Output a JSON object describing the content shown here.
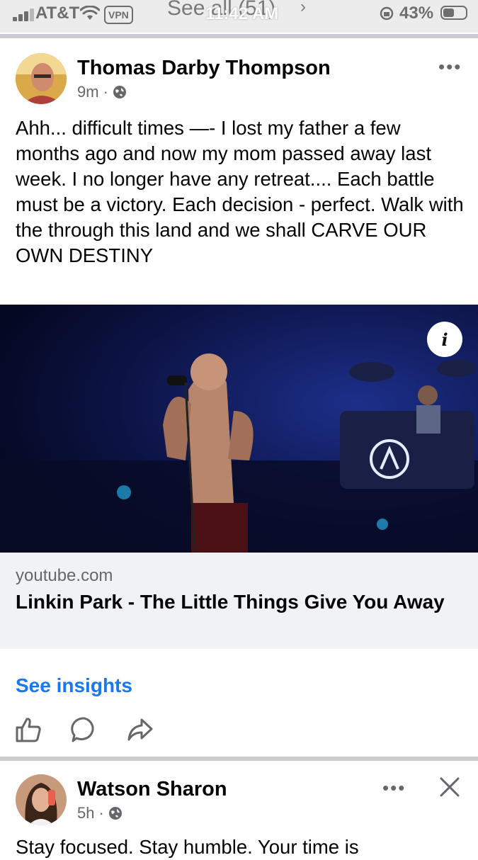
{
  "status_bar": {
    "carrier": "AT&T",
    "vpn_label": "VPN",
    "overlay_text": "See all (51)",
    "time": "11:42 AM",
    "battery_percent": "43%",
    "battery_level": 0.43
  },
  "post1": {
    "author": "Thomas Darby Thompson",
    "time_ago": "9m",
    "separator": "·",
    "audience_icon": "globe-icon",
    "more_icon": "more-dots-icon",
    "text": "Ahh... difficult times —- I lost my father a few months ago and now my mom passed away last week.  I no longer have any retreat.... Each battle must be a victory. Each decision - perfect.  Walk with the through this land and we shall CARVE OUR OWN DESTINY",
    "link": {
      "domain": "youtube.com",
      "title": "Linkin Park - The Little Things Give You Away",
      "info_label": "i"
    },
    "insights_label": "See insights",
    "actions": [
      "like-icon",
      "comment-icon",
      "share-icon"
    ]
  },
  "post2": {
    "author": "Watson Sharon",
    "time_ago": "5h",
    "separator": "·",
    "audience_icon": "globe-icon",
    "more_icon": "more-dots-icon",
    "close_icon": "close-icon",
    "text": "Stay focused. Stay humble. Your time is"
  },
  "colors": {
    "accent": "#1877f2",
    "meta_gray": "#65676b",
    "link_bg": "#f0f2f5",
    "divider": "#c9ccd1"
  }
}
